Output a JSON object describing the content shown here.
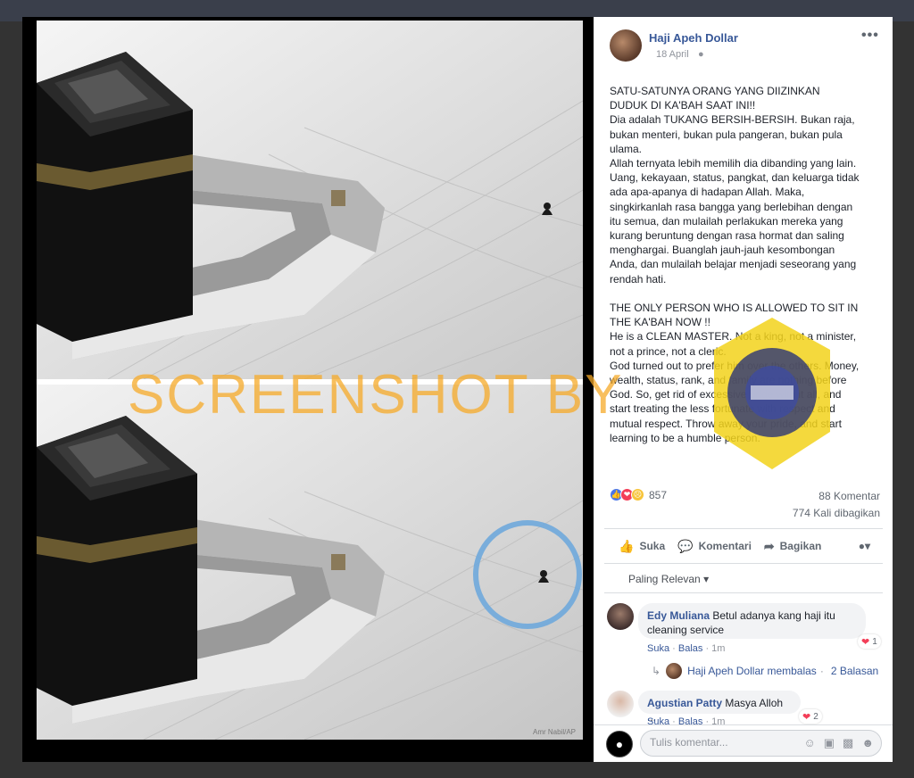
{
  "post": {
    "author": "Haji Apeh Dollar",
    "date": "18 April",
    "text": "SATU-SATUNYA ORANG YANG DIIZINKAN\nDUDUK DI KA'BAH SAAT INI!!\nDia adalah TUKANG BERSIH-BERSIH. Bukan raja,\nbukan menteri, bukan pula pangeran, bukan pula\nulama.\nAllah ternyata lebih memilih dia dibanding yang lain.\nUang, kekayaan, status, pangkat, dan keluarga tidak\nada apa-apanya di hadapan Allah. Maka,\nsingkirkanlah rasa bangga yang berlebihan dengan\nitu semua, dan mulailah perlakukan mereka yang\nkurang beruntung dengan rasa hormat dan saling\nmenghargai. Buanglah jauh-jauh kesombongan\nAnda, dan mulailah belajar menjadi seseorang yang\nrendah hati.\n\nTHE ONLY PERSON WHO IS ALLOWED TO SIT IN\nTHE KA'BAH NOW !!\nHe is a CLEAN MASTER. Not a king, not a minister,\nnot a prince, not a cleric.\nGod turned out to prefer him over the others. Money,\nwealth, status, rank, and family are nothing before\nGod. So, get rid of excessive pride with it all, and\nstart treating the less fortunate with respect and\nmutual respect. Throw away your pride, and start\nlearning to be a humble person.",
    "reaction_count": "857",
    "comments_count": "88 Komentar",
    "shares_count": "774 Kali dibagikan"
  },
  "photo": {
    "credit": "Amr Nabil/AP",
    "watermark": "SCREENSHOT BY"
  },
  "actions": {
    "like": "Suka",
    "comment": "Komentari",
    "share": "Bagikan"
  },
  "comments": {
    "sort_label": "Paling Relevan",
    "items": [
      {
        "name": "Edy Muliana",
        "text": "Betul adanya kang haji itu cleaning service",
        "like_label": "Suka",
        "reply_label": "Balas",
        "time": "1m",
        "reactions": "1"
      },
      {
        "name": "Agustian Patty",
        "text": "Masya Alloh ...",
        "like_label": "Suka",
        "reply_label": "Balas",
        "time": "1m",
        "reactions": "2"
      }
    ],
    "reply_summary": {
      "name": "Haji Apeh Dollar",
      "verb": "membalas",
      "count": "2 Balasan"
    }
  },
  "composer": {
    "placeholder": "Tulis komentar..."
  }
}
